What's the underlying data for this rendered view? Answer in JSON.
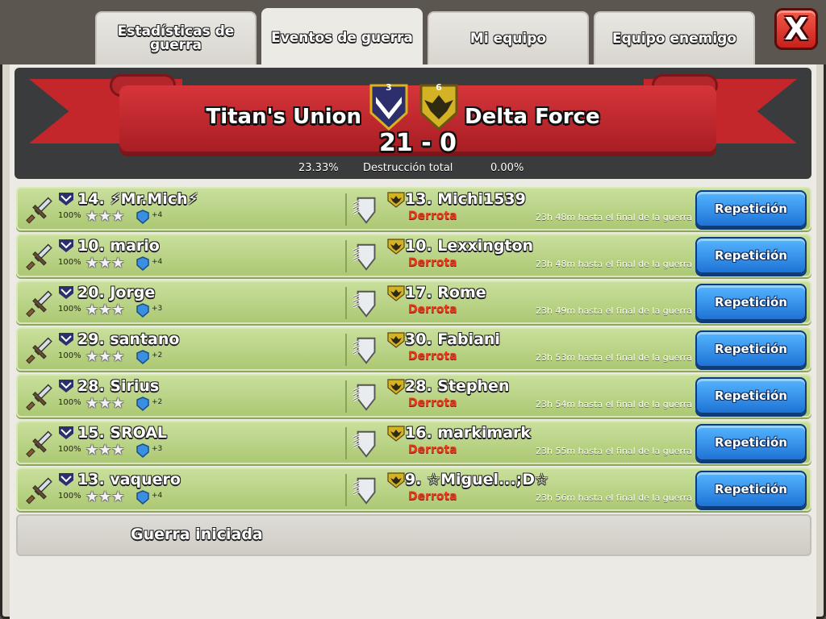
{
  "tabs": [
    {
      "label": "Estadísticas de guerra"
    },
    {
      "label": "Eventos de guerra"
    },
    {
      "label": "Mi equipo"
    },
    {
      "label": "Equipo enemigo"
    }
  ],
  "close_label": "X",
  "header": {
    "home_clan": "Titan's Union",
    "home_clan_level": "3",
    "enemy_clan": "Delta Force",
    "enemy_clan_level": "6",
    "score": "21 - 0",
    "home_destruction": "23.33%",
    "destruction_label": "Destrucción total",
    "enemy_destruction": "0.00%"
  },
  "events": [
    {
      "attacker": "14. ⚡Mr.Mich⚡",
      "percent": "100%",
      "trophies": "+4",
      "defender": "13. Michi1539",
      "result": "Derrota",
      "time": "23h 48m hasta el final de la guerra",
      "replay": "Repetición"
    },
    {
      "attacker": "10. mario",
      "percent": "100%",
      "trophies": "+4",
      "defender": "10. Lexxington",
      "result": "Derrota",
      "time": "23h 48m hasta el final de la guerra",
      "replay": "Repetición"
    },
    {
      "attacker": "20. Jorge",
      "percent": "100%",
      "trophies": "+3",
      "defender": "17. Rome",
      "result": "Derrota",
      "time": "23h 49m hasta el final de la guerra",
      "replay": "Repetición"
    },
    {
      "attacker": "29. santano",
      "percent": "100%",
      "trophies": "+2",
      "defender": "30. Fabiani",
      "result": "Derrota",
      "time": "23h 53m hasta el final de la guerra",
      "replay": "Repetición"
    },
    {
      "attacker": "28. Sirius",
      "percent": "100%",
      "trophies": "+2",
      "defender": "28. Stephen",
      "result": "Derrota",
      "time": "23h 54m hasta el final de la guerra",
      "replay": "Repetición"
    },
    {
      "attacker": "15. SROAL",
      "percent": "100%",
      "trophies": "+3",
      "defender": "16. markimark",
      "result": "Derrota",
      "time": "23h 55m hasta el final de la guerra",
      "replay": "Repetición"
    },
    {
      "attacker": "13. vaquero",
      "percent": "100%",
      "trophies": "+4",
      "defender": "9. ☆Miguel...;D☆",
      "result": "Derrota",
      "time": "23h 56m hasta el final de la guerra",
      "replay": "Repetición"
    }
  ],
  "stars": "★★★",
  "war_started_label": "Guerra iniciada",
  "colors": {
    "row_green": "#b9d384",
    "banner_red": "#c4272b",
    "replay_blue": "#1e73d6",
    "defeat_red": "#e33a1c"
  }
}
